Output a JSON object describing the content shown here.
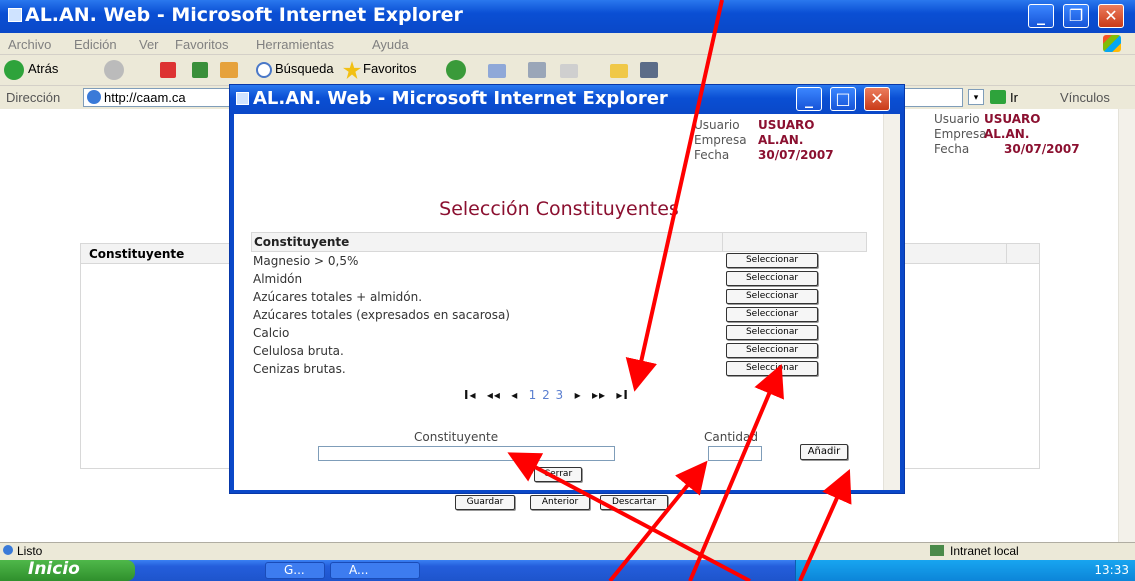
{
  "window": {
    "title": "AL.AN. Web - Microsoft Internet Explorer"
  },
  "menu": [
    "Archivo",
    "Edición",
    "Ver",
    "Favoritos",
    "Herramientas",
    "Ayuda"
  ],
  "toolbar": {
    "back": "Atrás",
    "search": "Búsqueda",
    "favorites": "Favoritos"
  },
  "addressbar": {
    "label": "Dirección",
    "url": "http://caam.ca",
    "go": "Ir",
    "links": "Vínculos"
  },
  "page": {
    "info": {
      "user_label": "Usuario",
      "user": "USUARO",
      "company_label": "Empresa",
      "company": "AL.AN.",
      "date_label": "Fecha",
      "date": "30/07/2007"
    },
    "table_header": "Constituyente",
    "buttons": {
      "save": "Guardar",
      "prev": "Anterior",
      "discard": "Descartar"
    }
  },
  "popup": {
    "title": "AL.AN. Web - Microsoft Internet Explorer",
    "info": {
      "user_label": "Usuario",
      "user": "USUARO",
      "company_label": "Empresa",
      "company": "AL.AN.",
      "date_label": "Fecha",
      "date": "30/07/2007"
    },
    "heading": "Selección Constituyentes",
    "table": {
      "header": "Constituyente",
      "select_label": "Seleccionar",
      "rows": [
        "Magnesio > 0,5%",
        "Almidón",
        "Azúcares totales + almidón.",
        "Azúcares totales (expresados en sacarosa)",
        "Calcio",
        "Celulosa bruta.",
        "Cenizas brutas."
      ]
    },
    "pager": {
      "first": "I◂",
      "prev_page": "◂◂",
      "prev": "◂",
      "pages": "1 2 3",
      "next": "▸",
      "next_page": "▸▸",
      "last": "▸I"
    },
    "form": {
      "constituent_label": "Constituyente",
      "constituent_value": "",
      "quantity_label": "Cantidad",
      "quantity_value": "",
      "add": "Añadir",
      "close": "Cerrar"
    }
  },
  "statusbar": {
    "status": "Listo",
    "zone": "Intranet local"
  },
  "taskbar": {
    "start": "Inicio",
    "tasks": [
      "G...",
      "A..."
    ],
    "time": "13:33"
  },
  "colors": {
    "xp_blue": "#0a48c8",
    "accent_text": "#8b1030",
    "annotation_arrow": "#ff0000"
  }
}
